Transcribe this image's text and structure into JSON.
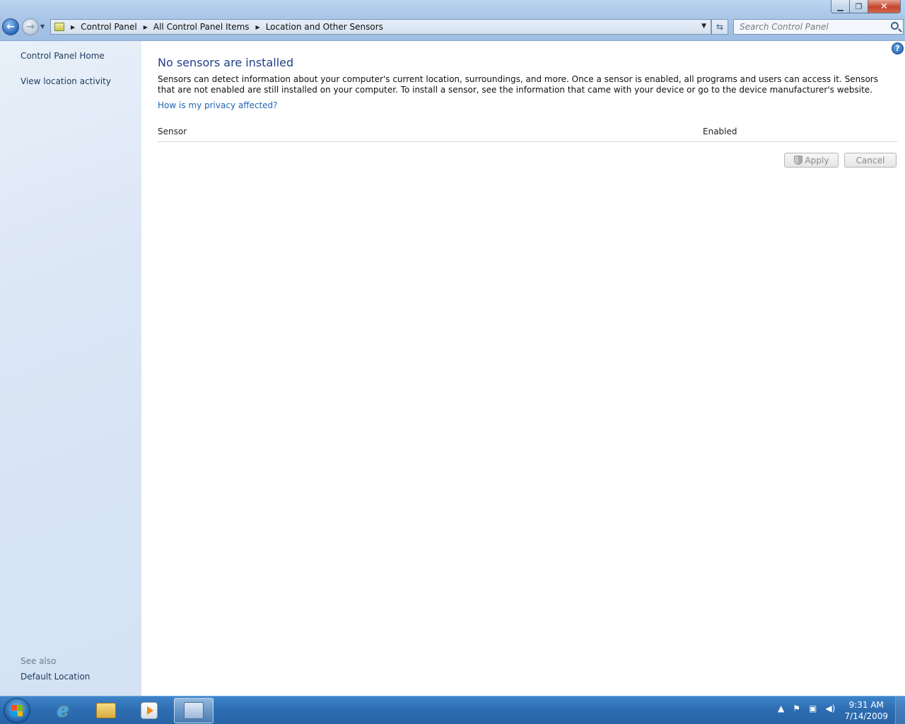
{
  "window": {
    "minimize_glyph": "▁",
    "maximize_glyph": "❐",
    "close_glyph": "✕"
  },
  "addressbar": {
    "crumbs": [
      "Control Panel",
      "All Control Panel Items",
      "Location and Other Sensors"
    ]
  },
  "search": {
    "placeholder": "Search Control Panel"
  },
  "sidebar": {
    "links": [
      "Control Panel Home",
      "View location activity"
    ],
    "see_also_label": "See also",
    "see_also_links": [
      "Default Location"
    ]
  },
  "main": {
    "title": "No sensors are installed",
    "description": "Sensors can detect information about your computer's current location, surroundings, and more. Once a sensor is enabled, all programs and users can access it. Sensors that are not enabled are still installed on your computer. To install a sensor, see the information that came with your device or go to the device manufacturer's website.",
    "privacy_link": "How is my privacy affected?",
    "columns": {
      "sensor": "Sensor",
      "enabled": "Enabled"
    },
    "buttons": {
      "apply": "Apply",
      "cancel": "Cancel"
    }
  },
  "taskbar": {
    "items": [
      "internet-explorer-icon",
      "windows-explorer-icon",
      "media-player-icon",
      "control-panel-icon"
    ],
    "active_item": "control-panel-icon",
    "clock": {
      "time": "9:31 AM",
      "date": "7/14/2009"
    }
  },
  "colors": {
    "title_blue": "#1e3f8a",
    "link_blue": "#1e64b5",
    "taskbar": "#2d6cb0"
  }
}
